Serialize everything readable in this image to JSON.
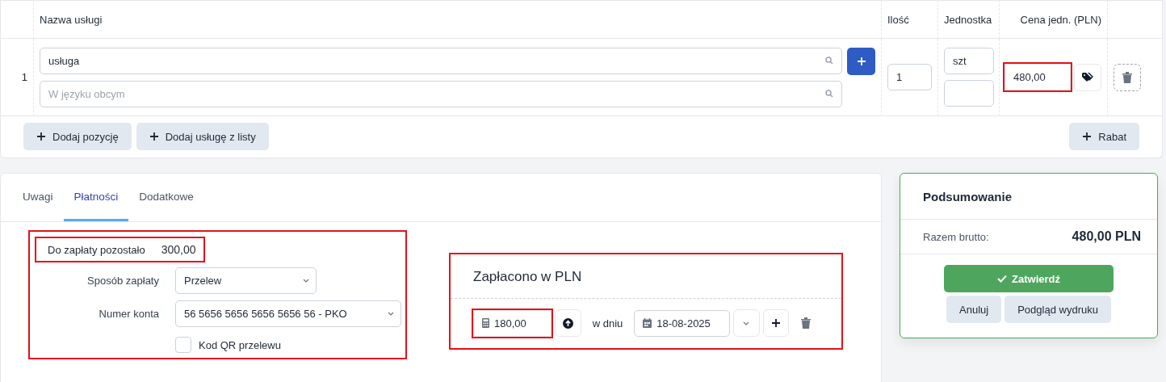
{
  "table": {
    "columns": [
      "Nazwa usługi",
      "Ilość",
      "Jednostka",
      "Cena jedn. (PLN)"
    ],
    "rows": [
      {
        "index": "1",
        "name": "usługa",
        "foreign_placeholder": "W języku obcym",
        "quantity": "1",
        "unit": "szt",
        "price": "480,00",
        "price_highlighted": true
      }
    ],
    "buttons": [
      "Dodaj pozycję",
      "Dodaj usługę z listy"
    ],
    "discount_button": "Rabat"
  },
  "tabs": [
    {
      "label": "Uwagi",
      "selected": false
    },
    {
      "label": "Płatności",
      "selected": true
    },
    {
      "label": "Dodatkowe",
      "selected": false
    }
  ],
  "payment": {
    "highlighted": true,
    "remaining": {
      "label": "Do zapłaty pozostało",
      "value": "300,00",
      "highlighted": true
    },
    "method": {
      "label": "Sposób zapłaty",
      "value": "Przelew"
    },
    "account": {
      "label": "Numer konta",
      "value": "56 5656 5656 5656 5656 56 - PKO"
    },
    "qr": {
      "label": "Kod QR przelewu",
      "checked": false
    }
  },
  "paid": {
    "title": "Zapłacono w PLN",
    "highlighted": true,
    "amount": "180,00",
    "amount_highlighted": true,
    "date_label": "w dniu",
    "date": "18-08-2025"
  },
  "summary": {
    "title": "Podsumowanie",
    "total_label": "Razem brutto:",
    "total_value": "480,00 PLN",
    "confirm": "Zatwierdź",
    "cancel": "Anuluj",
    "preview": "Podgląd wydruku"
  }
}
